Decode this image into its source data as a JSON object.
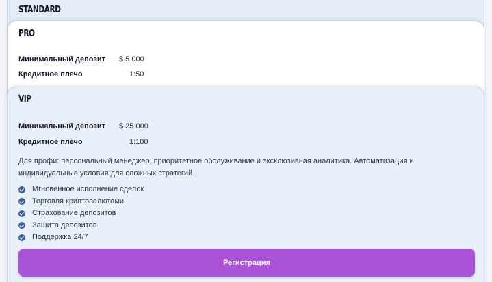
{
  "plans": {
    "standard": {
      "title": "STANDARD"
    },
    "pro": {
      "title": "PRO",
      "min_deposit_label": "Минимальный депозит",
      "min_deposit_value": "$ 5 000",
      "leverage_label": "Кредитное плечо",
      "leverage_value": "1:50"
    },
    "vip": {
      "title": "VIP",
      "min_deposit_label": "Минимальный депозит",
      "min_deposit_value": "$ 25 000",
      "leverage_label": "Кредитное плечо",
      "leverage_value": "1:100",
      "description": "Для профи: персональный менеджер, приоритетное обслуживание и эксклюзивная аналитика. Автоматизация и индивидуальные условия для сложных стратегий.",
      "features": [
        "Мгновенное исполнение сделок",
        "Торговля криптовалютами",
        "Страхование депозитов",
        "Защита депозитов",
        "Поддержка 24/7"
      ],
      "button_label": "Регистрация"
    }
  },
  "colors": {
    "accent": "#aa52d8",
    "check": "#3b5f95",
    "vip_bg": "#eaf0fb",
    "standard_bg": "#e4ecf7"
  },
  "icons": {
    "feature": "check-circle-icon"
  }
}
